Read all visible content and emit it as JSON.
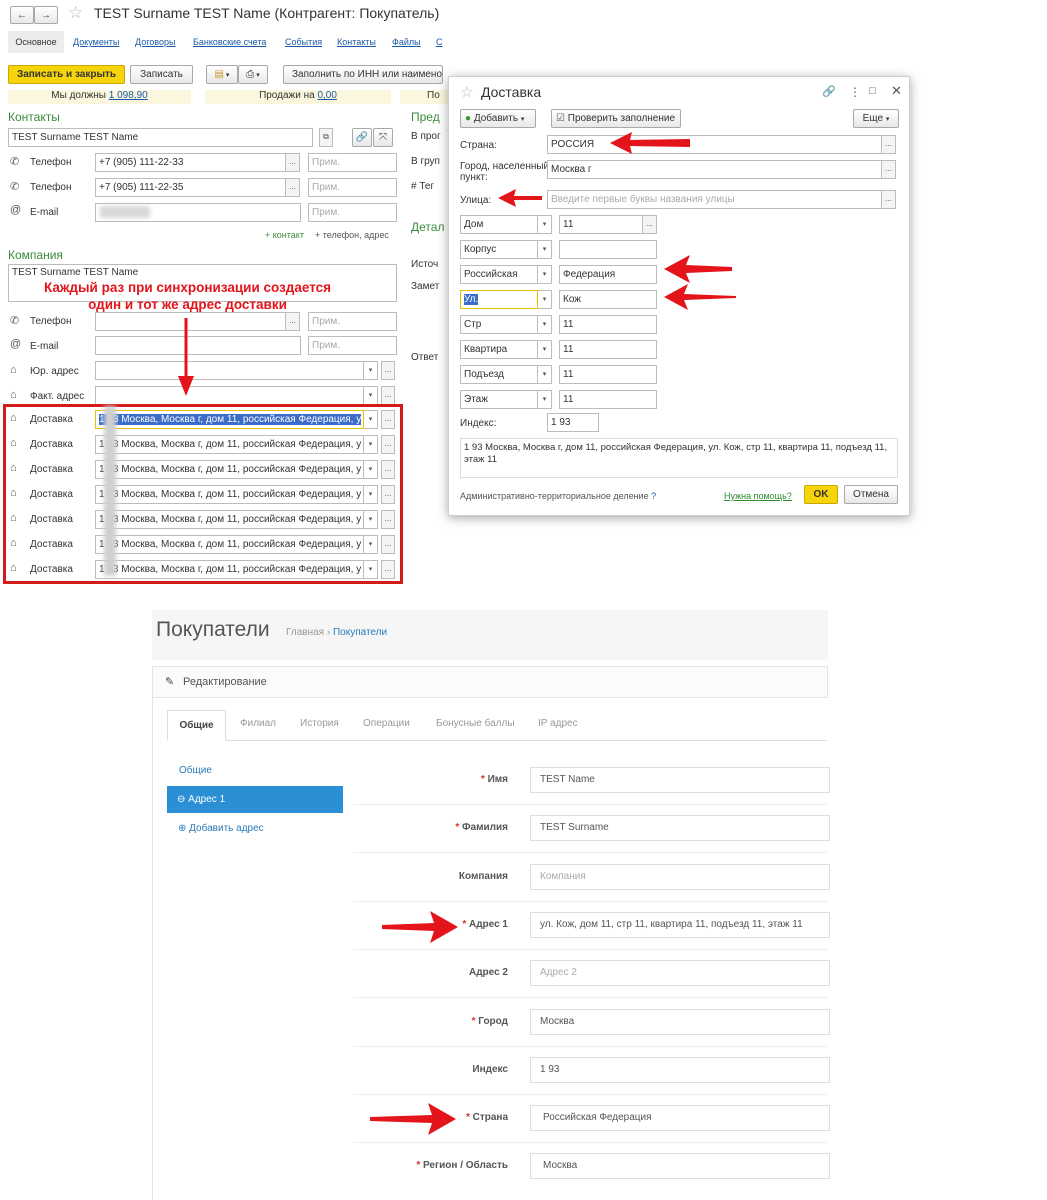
{
  "form1c": {
    "title": "TEST Surname TEST Name (Контрагент: Покупатель)",
    "tabs": [
      "Основное",
      "Документы",
      "Договоры",
      "Банковские счета",
      "События",
      "Контакты",
      "Файлы",
      "С"
    ],
    "toolbar": {
      "save_close": "Записать и закрыть",
      "save": "Записать",
      "fill_inn": "Заполнить по ИНН или наимено"
    },
    "balance": {
      "we_owe_label": "Мы должны",
      "we_owe_value": "1 098,90",
      "sales_label": "Продажи на",
      "sales_value": "0,00",
      "po": "По"
    },
    "contacts": {
      "section": "Контакты",
      "name": "TEST Surname TEST Name",
      "phone1_label": "Телефон",
      "phone1_value": "+7 (905) 111-22-33",
      "phone1_note": "Прим.",
      "phone2_label": "Телефон",
      "phone2_value": "+7 (905) 111-22-35",
      "phone2_note": "Прим.",
      "email_label": "E-mail",
      "email_note": "Прим.",
      "add_contact": "+ контакт",
      "add_phone": "+ телефон, адрес"
    },
    "company": {
      "section": "Компания",
      "name": "TEST Surname TEST Name",
      "phone_label": "Телефон",
      "phone_note": "Прим.",
      "email_label": "E-mail",
      "email_note": "Прим.",
      "legal_label": "Юр. адрес",
      "fact_label": "Факт. адрес",
      "delivery_label": "Доставка",
      "delivery_rows": [
        "1    93 Москва, Москва г, дом 11, российская Федерация, у",
        "1    93 Москва, Москва г, дом 11, российская Федерация, у",
        "1    93 Москва, Москва г, дом 11, российская Федерация, у",
        "1    93 Москва, Москва г, дом 11, российская Федерация, у",
        "1    93 Москва, Москва г, дом 11, российская Федерация, у",
        "1    93 Москва, Москва г, дом 11, российская Федерация, у",
        "1    93 Москва, Москва г, дом 11, российская Федерация, у"
      ]
    },
    "annotation": "Каждый раз при синхронизации создается\nодин и тот же адрес доставки",
    "right_col": {
      "pred": "Пред",
      "v_prog": "В прог",
      "v_grup": "В груп",
      "teg": "# Тег",
      "detal": "Детал",
      "istoch": "Источ",
      "zamet": "Замет",
      "otvet": "Ответ"
    }
  },
  "modal": {
    "title": "Доставка",
    "add_btn": "Добавить",
    "check_btn": "Проверить заполнение",
    "more_btn": "Еще",
    "country_label": "Страна:",
    "country_value": "РОССИЯ",
    "city_label": "Город, населенный пункт:",
    "city_value": "Москва г",
    "street_label": "Улица:",
    "street_placeholder": "Введите первые буквы названия улицы",
    "rows": [
      {
        "type": "Дом",
        "value": "11",
        "dots": true
      },
      {
        "type": "Корпус",
        "value": "",
        "dots": false
      },
      {
        "type": "Российская",
        "value": "Федерация",
        "dots": false
      },
      {
        "type": "Ул.",
        "value": "Кож",
        "dots": false
      },
      {
        "type": "Стр",
        "value": "11",
        "dots": false
      },
      {
        "type": "Квартира",
        "value": "11",
        "dots": false
      },
      {
        "type": "Подъезд",
        "value": "11",
        "dots": false
      },
      {
        "type": "Этаж",
        "value": "11",
        "dots": false
      }
    ],
    "index_label": "Индекс:",
    "index_value": "1    93",
    "full_address": "1     93 Москва, Москва г, дом 11, российская Федерация, ул. Кож, стр 11, квартира 11, подъезд 11, этаж 11",
    "admin_link": "Административно-территориальное деление",
    "help_link": "Нужна помощь?",
    "ok": "OK",
    "cancel": "Отмена"
  },
  "admin": {
    "title": "Покупатели",
    "breadcrumb_home": "Главная",
    "breadcrumb_sep": "›",
    "breadcrumb_current": "Покупатели",
    "panel_title": "Редактирование",
    "tabs": [
      "Общие",
      "Филиал",
      "История",
      "Операции",
      "Бонусные баллы",
      "IP адрес"
    ],
    "side": {
      "general": "Общие",
      "address1": "Адрес 1",
      "add_address": "Добавить адрес"
    },
    "fields": [
      {
        "label": "Имя",
        "required": true,
        "value": "TEST Name",
        "placeholder": false
      },
      {
        "label": "Фамилия",
        "required": true,
        "value": "TEST Surname",
        "placeholder": false
      },
      {
        "label": "Компания",
        "required": false,
        "value": "Компания",
        "placeholder": true
      },
      {
        "label": "Адрес 1",
        "required": true,
        "value": "ул. Кож, дом 11, стр 11, квартира 11, подъезд 11, этаж 11",
        "placeholder": false
      },
      {
        "label": "Адрес 2",
        "required": false,
        "value": "Адрес 2",
        "placeholder": true
      },
      {
        "label": "Город",
        "required": true,
        "value": "Москва",
        "placeholder": false
      },
      {
        "label": "Индекс",
        "required": false,
        "value": "1    93",
        "placeholder": false
      },
      {
        "label": "Страна",
        "required": true,
        "value": "Российская Федерация",
        "placeholder": false
      },
      {
        "label": "Регион / Область",
        "required": true,
        "value": "Москва",
        "placeholder": false
      }
    ]
  },
  "colors": {
    "accent_green": "#3a8a3a",
    "red": "#e3141a",
    "yellow_btn": "#f5d40a",
    "blue_select": "#2b8fd6",
    "link_blue": "#1a5aa6"
  }
}
